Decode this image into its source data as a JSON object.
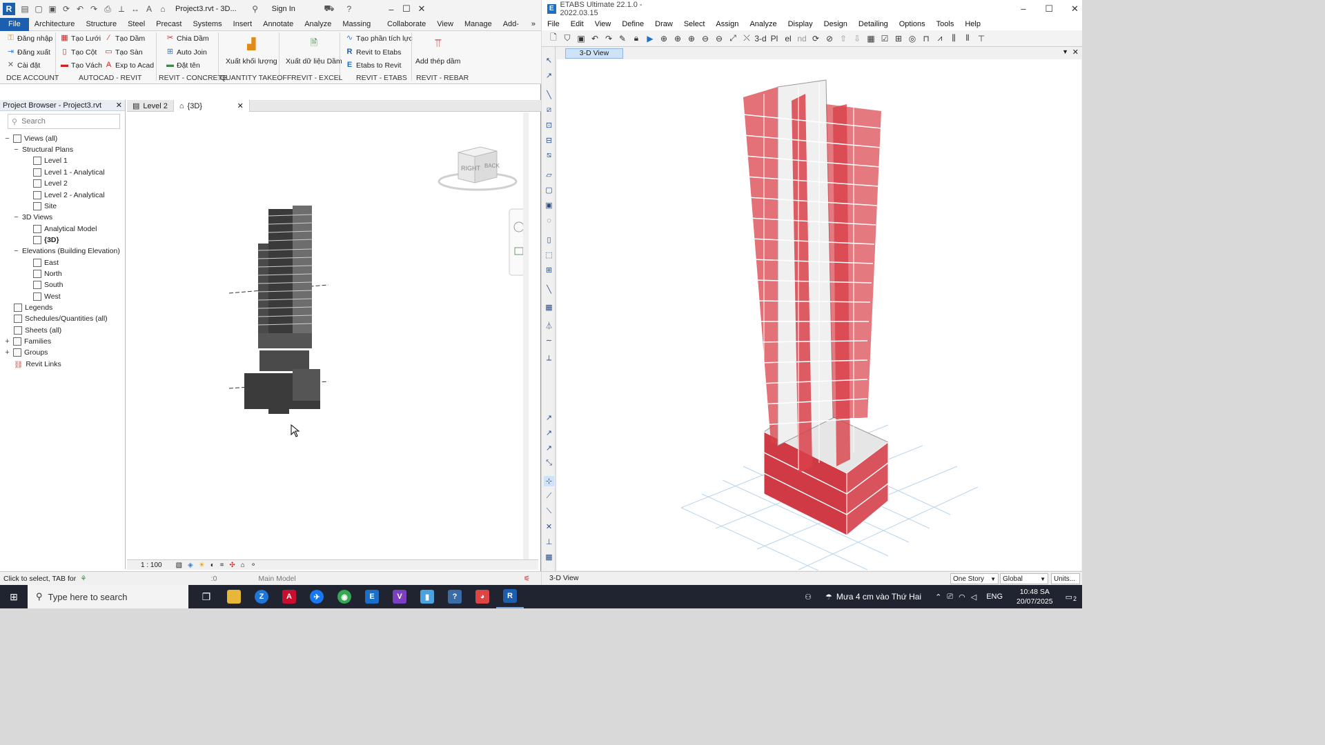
{
  "revit": {
    "title": "Project3.rvt - 3D...",
    "sign_in": "Sign In",
    "tabs": [
      "File",
      "Architecture",
      "Structure",
      "Steel",
      "Precast",
      "Systems",
      "Insert",
      "Annotate",
      "Analyze",
      "Massing & Site",
      "Collaborate",
      "View",
      "Manage",
      "Add-Ins"
    ],
    "ribbon": {
      "dce": [
        "Đăng nhập",
        "Đăng xuất",
        "Cài đặt"
      ],
      "autocad": [
        "Tạo Lưới",
        "Tạo Cột",
        "Tạo Vách",
        "Tạo Dầm",
        "Tạo Sàn",
        "Exp to Acad"
      ],
      "concrete": [
        "Chia Dầm",
        "Auto Join",
        "Đặt tên"
      ],
      "qto_btn": "Xuất khối lượng",
      "excel_btn": "Xuất dữ liệu Dầm",
      "etabs": [
        "Tạo phần tích lực",
        "Revit to Etabs",
        "Etabs to Revit"
      ],
      "rebar_btn": "Add thép dầm",
      "groups": [
        "DCE ACCOUNT",
        "AUTOCAD - REVIT",
        "REVIT - CONCRETE",
        "QUANTITY TAKEOFF",
        "REVIT - EXCEL",
        "REVIT - ETABS",
        "REVIT - REBAR"
      ]
    },
    "browser": {
      "title": "Project Browser - Project3.rvt",
      "search_placeholder": "Search",
      "nodes": [
        "Views (all)",
        "Structural Plans",
        "Level 1",
        "Level 1 - Analytical",
        "Level 2",
        "Level 2 - Analytical",
        "Site",
        "3D Views",
        "Analytical Model",
        "{3D}",
        "Elevations (Building Elevation)",
        "East",
        "North",
        "South",
        "West",
        "Legends",
        "Schedules/Quantities (all)",
        "Sheets (all)",
        "Families",
        "Groups",
        "Revit Links"
      ]
    },
    "view_tabs": [
      "Level 2",
      "{3D}"
    ],
    "viewcube": {
      "face_right": "RIGHT",
      "face_back": "BACK"
    },
    "scale": "1 : 100",
    "status": {
      "hint": "Click to select, TAB for",
      "zero": ":0",
      "model": "Main Model"
    }
  },
  "etabs": {
    "title": "ETABS Ultimate 22.1.0 - 2022.03.15",
    "menu": [
      "File",
      "Edit",
      "View",
      "Define",
      "Draw",
      "Select",
      "Assign",
      "Analyze",
      "Display",
      "Design",
      "Detailing",
      "Options",
      "Tools",
      "Help"
    ],
    "toolbar_text": {
      "three_d": "3-d",
      "pl": "Pl",
      "el": "el",
      "nd": "nd"
    },
    "view_tab": "3-D View",
    "status": {
      "view": "3-D View",
      "story": "One Story",
      "coord": "Global",
      "units": "Units..."
    }
  },
  "taskbar": {
    "search_placeholder": "Type here to search",
    "weather": "Mưa 4 cm vào Thứ Hai",
    "lang": "ENG",
    "time": "10:48 SA",
    "date": "20/07/2025",
    "notif_count": "2"
  },
  "colors": {
    "revit_blue": "#1b5fae",
    "etabs_blue": "#1b6fc8",
    "wall_red": "#d9414a",
    "taskbar": "#202431"
  }
}
